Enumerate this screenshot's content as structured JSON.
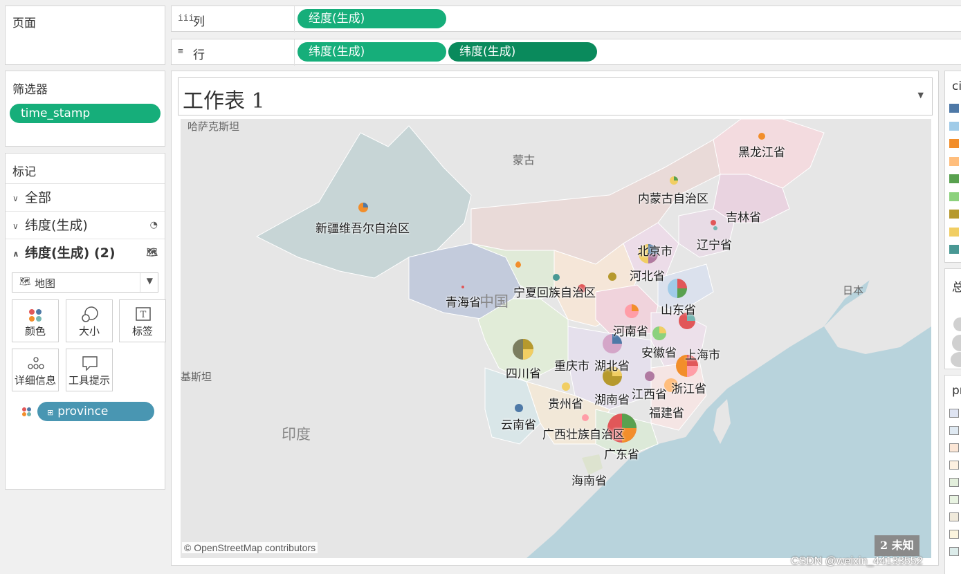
{
  "pages_card": {
    "title": "页面"
  },
  "shelves": {
    "columns": {
      "label": "列",
      "pills": [
        "经度(生成)"
      ]
    },
    "rows": {
      "label": "行",
      "pills": [
        "纬度(生成)",
        "纬度(生成)"
      ]
    }
  },
  "filters_card": {
    "title": "筛选器",
    "pills": [
      "time_stamp"
    ]
  },
  "marks_card": {
    "title": "标记",
    "rows": [
      {
        "label": "全部",
        "chevron": "chevron-down-icon"
      },
      {
        "label": "纬度(生成)",
        "chevron": "chevron-down-icon",
        "icon": "pie-chart-icon"
      },
      {
        "label": "纬度(生成) (2)",
        "chevron": "chevron-up-icon",
        "icon": "map-icon"
      }
    ],
    "mark_type": "地图",
    "buttons": [
      {
        "label": "颜色",
        "icon": "color-dots-icon"
      },
      {
        "label": "大小",
        "icon": "size-icon"
      },
      {
        "label": "标签",
        "icon": "text-label-icon"
      },
      {
        "label": "详细信息",
        "icon": "detail-dots-icon"
      },
      {
        "label": "工具提示",
        "icon": "tooltip-icon"
      }
    ],
    "field_pill": "province"
  },
  "worksheet": {
    "title": "工作表 1",
    "map": {
      "attribution": "© OpenStreetMap contributors",
      "unknown_badge": "2 未知",
      "country_labels": [
        "哈萨克斯坦",
        "蒙古",
        "中国",
        "印度",
        "日本",
        "基斯坦"
      ],
      "provinces": [
        "黑龙江省",
        "吉林省",
        "辽宁省",
        "内蒙古自治区",
        "新疆维吾尔自治区",
        "北京市",
        "河北省",
        "山东省",
        "宁夏回族自治区",
        "青海省",
        "河南省",
        "安徽省",
        "上海市",
        "四川省",
        "重庆市",
        "湖北省",
        "浙江省",
        "江西省",
        "贵州省",
        "湖南省",
        "福建省",
        "云南省",
        "广西壮族自治区",
        "广东省",
        "海南省"
      ]
    }
  },
  "legends": {
    "color_title": "ci",
    "size_title": "总",
    "province_title": "pr",
    "palette": [
      "#4e79a7",
      "#a0cbe8",
      "#f28e2b",
      "#ffbe7d",
      "#59a14f",
      "#8cd17d",
      "#b6992d",
      "#f1ce63",
      "#499894"
    ],
    "region_palette": [
      "#dfe4f2",
      "#dfe9f2",
      "#fbe6d6",
      "#fdf0e0",
      "#e3efdc",
      "#e8f3e1",
      "#f0eadb",
      "#fbf4de",
      "#dcecea"
    ]
  },
  "watermark": "CSDN @weixin_44133552"
}
